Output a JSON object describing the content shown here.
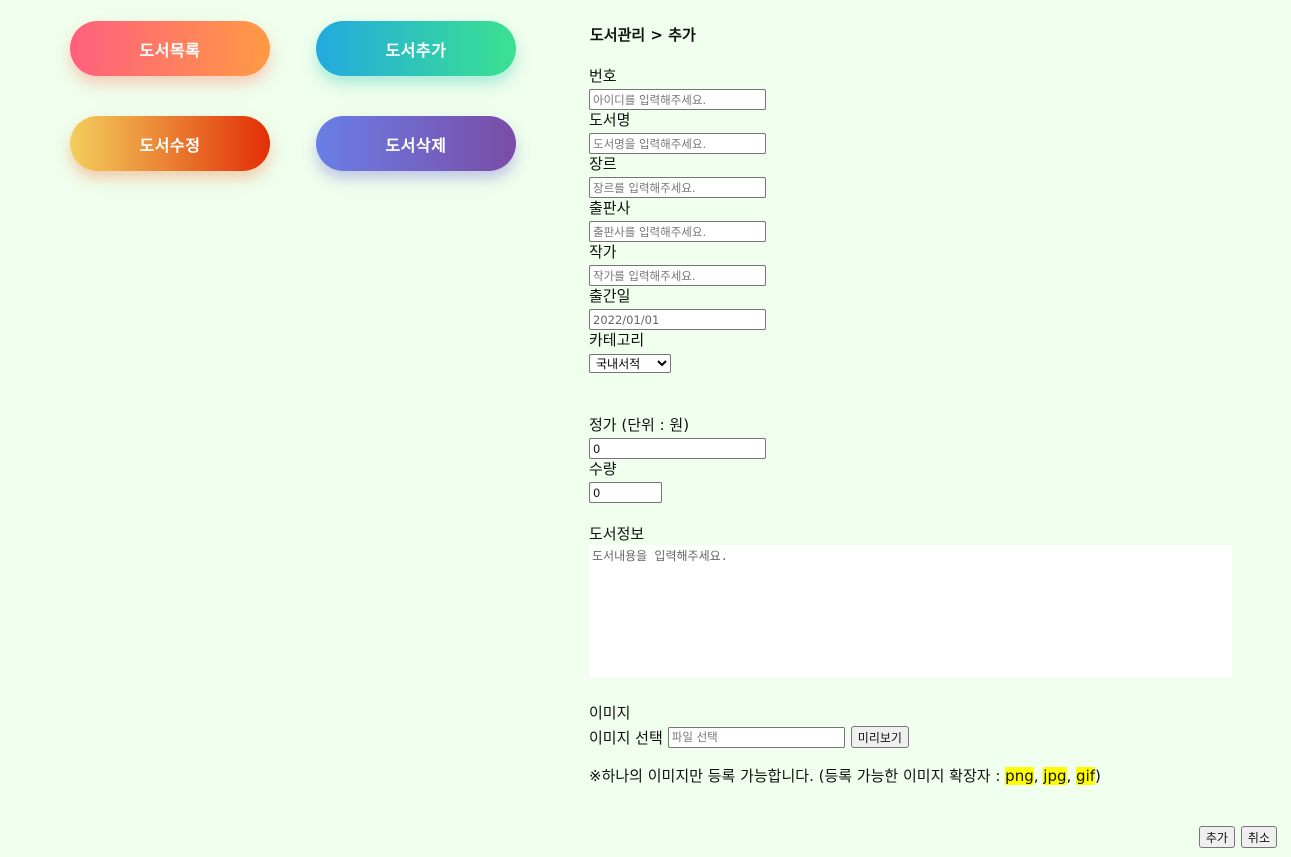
{
  "nav": {
    "list": "도서목록",
    "add": "도서추가",
    "edit": "도서수정",
    "delete": "도서삭제"
  },
  "breadcrumb": "도서관리 > 추가",
  "fields": {
    "id": {
      "label": "번호",
      "placeholder": "아이디를 입력해주세요."
    },
    "title": {
      "label": "도서명",
      "placeholder": "도서명을 입력해주세요."
    },
    "genre": {
      "label": "장르",
      "placeholder": "장르를 입력해주세요."
    },
    "publisher": {
      "label": "출판사",
      "placeholder": "출판사를 입력해주세요."
    },
    "author": {
      "label": "작가",
      "placeholder": "작가를 입력해주세요."
    },
    "pub_date": {
      "label": "출간일",
      "value": "2022/01/01"
    },
    "category": {
      "label": "카테고리",
      "selected": "국내서적"
    },
    "price": {
      "label": "정가 (단위 : 원)",
      "value": "0"
    },
    "quantity": {
      "label": "수량",
      "value": "0"
    },
    "info": {
      "label": "도서정보",
      "placeholder": "도서내용을 입력해주세요."
    }
  },
  "image": {
    "label": "이미지",
    "select_label": "이미지 선택",
    "file_placeholder": "파일 선택",
    "preview_button": "미리보기",
    "note_prefix": "※하나의 이미지만 등록 가능합니다. (등록 가능한 이미지 확장자 : ",
    "ext_png": "png",
    "ext_jpg": "jpg",
    "ext_gif": "gif",
    "sep": ", ",
    "note_suffix": ")"
  },
  "actions": {
    "add": "추가",
    "cancel": "취소"
  }
}
